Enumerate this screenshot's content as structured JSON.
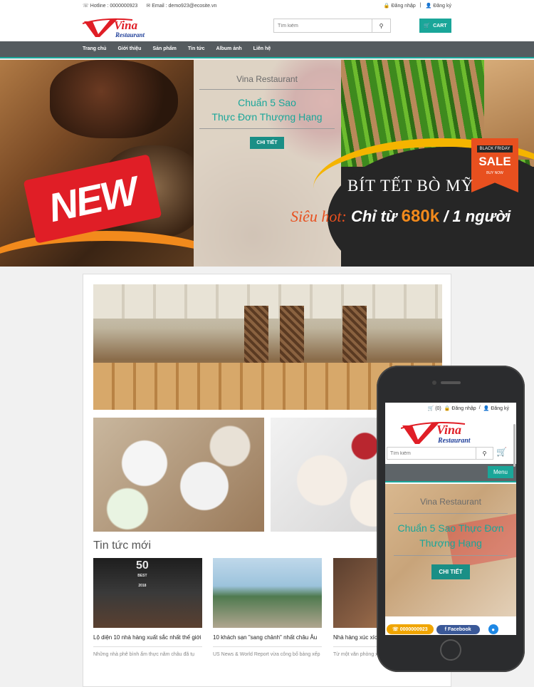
{
  "topbar": {
    "hotline": "Hotline : 0000000923",
    "email": "Email : demo923@ecosite.vn",
    "login": "Đăng nhập",
    "separator": "|",
    "register": "Đăng ký"
  },
  "header": {
    "logo_text": "Vina",
    "logo_sub": "Restaurant",
    "search_placeholder": "Tìm kiếm",
    "cart_label": "CART"
  },
  "nav": {
    "items": [
      "Trang chủ",
      "Giới thiệu",
      "Sản phẩm",
      "Tin tức",
      "Album ảnh",
      "Liên hệ"
    ]
  },
  "hero": {
    "new_badge": "NEW",
    "brand": "Vina Restaurant",
    "title_line1": "Chuẩn 5 Sao",
    "title_line2": "Thực Đơn Thượng Hạng",
    "detail_button": "CHI TIẾT",
    "sale_top": "BLACK FRIDAY",
    "sale_main": "SALE",
    "sale_bottom": "BUY NOW",
    "beef_title": "BÍT TẾT BÒ MỸ",
    "promo_a": "Siêu hot:",
    "promo_b": "Chỉ từ",
    "promo_c": "680k",
    "promo_d": "/ 1 người"
  },
  "news": {
    "section_title": "Tin tức mới",
    "thumb1_badge": "50",
    "thumb1_badge_title": "BEST",
    "thumb1_badge_year": "2018",
    "items": [
      {
        "title": "Lộ diện 10 nhà hàng xuất sắc nhất thế giới",
        "desc": "Những nhà phê bình ẩm thực nằm châu đã tụ"
      },
      {
        "title": "10 khách sạn \"sang chảnh\" nhất châu Âu",
        "desc": "US News & World Report vừa công bố bảng xếp"
      },
      {
        "title": "Nhà hàng xúc xích khách ở Đức",
        "desc": "Từ một văn phòng xây dựng nhỏ nằm bên sông"
      }
    ]
  },
  "mobile": {
    "cart_count": "(0)",
    "login": "Đăng nhập",
    "separator": "/",
    "register": "Đăng ký",
    "logo_text": "Vina",
    "logo_sub": "Restaurant",
    "search_placeholder": "Tìm kiếm",
    "menu_button": "Menu",
    "brand": "Vina Restaurant",
    "title": "Chuẩn 5 Sao Thực Đơn Thượng Hạng",
    "detail_button": "CHI TIẾT",
    "hotline": "0000000923",
    "facebook": "Facebook"
  },
  "colors": {
    "accent": "#1aa699",
    "nav_bg": "#555b5f",
    "logo_red": "#e01e26",
    "logo_blue": "#1f3f9a"
  }
}
